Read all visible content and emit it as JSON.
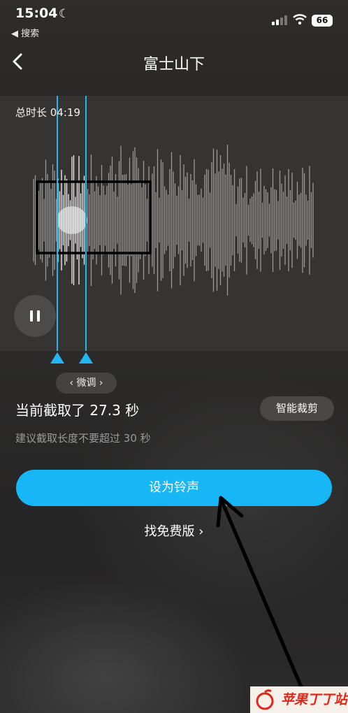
{
  "status_bar": {
    "time": "15:04",
    "back_label": "◀ 搜索",
    "battery": "66"
  },
  "nav": {
    "title": "富士山下"
  },
  "wave": {
    "total_duration": "总时长 04:19",
    "fine_tune_label": "‹ 微调 ›"
  },
  "selection": {
    "text": "当前截取了 27.3 秒",
    "hint": "建议截取长度不要超过 30 秒"
  },
  "buttons": {
    "smart_trim": "智能裁剪",
    "set_ringtone": "设为铃声",
    "free_version": "找免费版 ›"
  },
  "watermark": {
    "text": "苹果丁丁站"
  },
  "colors": {
    "accent": "#17b6f7",
    "panel": "#363433"
  }
}
